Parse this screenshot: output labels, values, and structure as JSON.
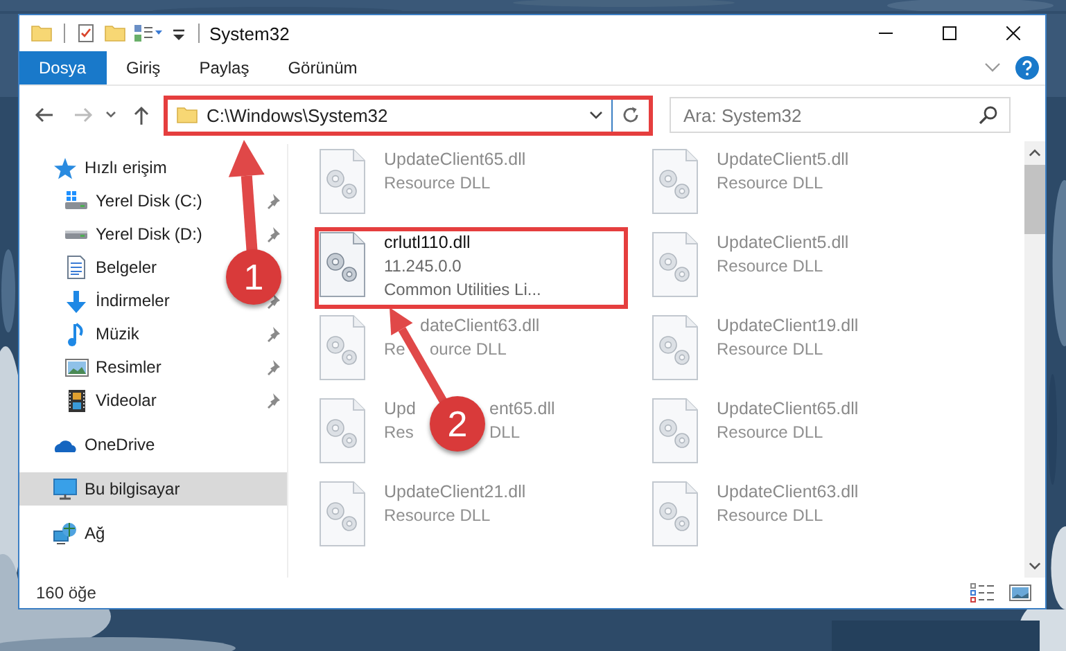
{
  "window": {
    "title": "System32"
  },
  "ribbon_tabs": [
    {
      "label": "Dosya",
      "kind": "file"
    },
    {
      "label": "Giriş",
      "kind": "tab"
    },
    {
      "label": "Paylaş",
      "kind": "tab"
    },
    {
      "label": "Görünüm",
      "kind": "tab"
    }
  ],
  "address_bar": {
    "path": "C:\\Windows\\System32",
    "highlighted": true
  },
  "search": {
    "placeholder": "Ara: System32"
  },
  "sidebar": {
    "items": [
      {
        "label": "Hızlı erişim",
        "kind": "star",
        "selected": false,
        "children": [
          {
            "label": "Yerel Disk (C:)",
            "kind": "system-drive",
            "pinned": true,
            "selected": false
          },
          {
            "label": "Yerel Disk (D:)",
            "kind": "drive",
            "pinned": true,
            "selected": false
          },
          {
            "label": "Belgeler",
            "kind": "documents",
            "selected": false
          },
          {
            "label": "İndirmeler",
            "kind": "downloads",
            "pinned": true,
            "selected": false
          },
          {
            "label": "Müzik",
            "kind": "music",
            "pinned": true,
            "selected": false
          },
          {
            "label": "Resimler",
            "kind": "pictures",
            "pinned": true,
            "selected": false
          },
          {
            "label": "Videolar",
            "kind": "videos",
            "pinned": true,
            "selected": false
          }
        ]
      },
      {
        "label": "OneDrive",
        "kind": "cloud",
        "selected": false
      },
      {
        "label": "Bu bilgisayar",
        "kind": "computer",
        "selected": true
      },
      {
        "label": "Ağ",
        "kind": "network",
        "selected": false
      }
    ]
  },
  "files": [
    {
      "name": "UpdateClient65.dll",
      "details": [
        "Resource DLL"
      ],
      "faded": true,
      "highlighted": false
    },
    {
      "name": "UpdateClient5.dll",
      "details": [
        "Resource DLL"
      ],
      "faded": true,
      "highlighted": false
    },
    {
      "name": "crlutl110.dll",
      "details": [
        "11.245.0.0",
        "Common Utilities Li..."
      ],
      "faded": false,
      "highlighted": true
    },
    {
      "name": "UpdateClient5.dll",
      "details": [
        "Resource DLL"
      ],
      "faded": true,
      "highlighted": false
    },
    {
      "name": [
        "dateClient63.dll"
      ],
      "details": [
        [
          "Re",
          "ource DLL"
        ]
      ],
      "faded": true,
      "highlighted": false
    },
    {
      "name": "UpdateClient19.dll",
      "details": [
        "Resource DLL"
      ],
      "faded": true,
      "highlighted": false
    },
    {
      "name": [
        "Upd",
        "ent65.dll"
      ],
      "details": [
        [
          "Res",
          "DLL"
        ]
      ],
      "faded": true,
      "highlighted": false
    },
    {
      "name": "UpdateClient65.dll",
      "details": [
        "Resource DLL"
      ],
      "faded": true,
      "highlighted": false
    },
    {
      "name": "UpdateClient21.dll",
      "details": [
        "Resource DLL"
      ],
      "faded": true,
      "highlighted": false
    },
    {
      "name": "UpdateClient63.dll",
      "details": [
        "Resource DLL"
      ],
      "faded": true,
      "highlighted": false
    }
  ],
  "status_bar": {
    "item_count": "160 öğe"
  },
  "callouts": [
    {
      "number": "1"
    },
    {
      "number": "2"
    }
  ]
}
